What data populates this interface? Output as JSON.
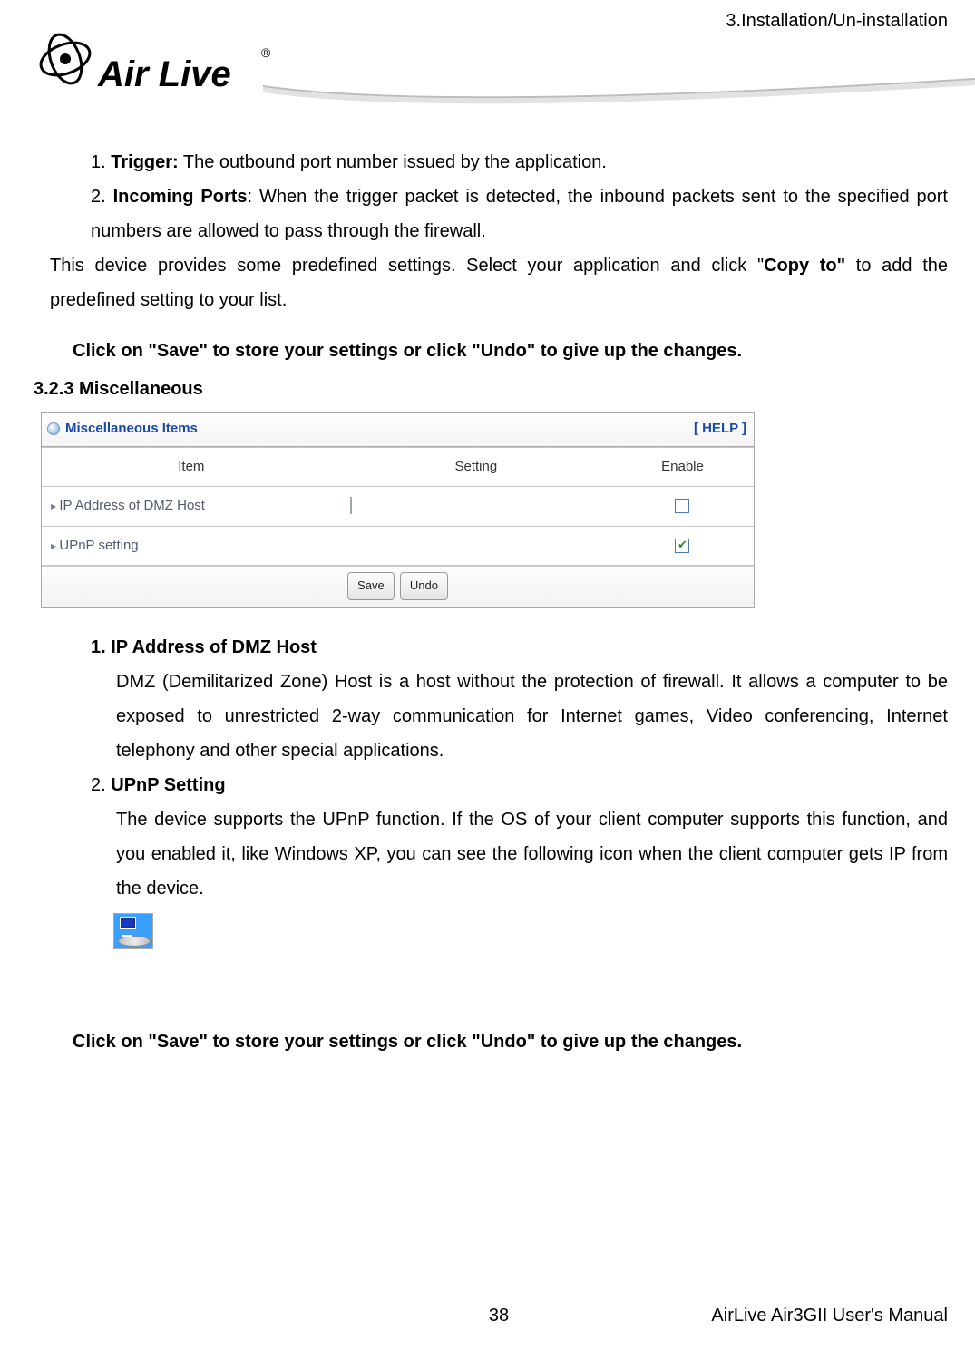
{
  "header": {
    "breadcrumb": "3.Installation/Un-installation",
    "brand_word1": "Air",
    "brand_word2": "Live",
    "brand_reg": "®"
  },
  "intro": {
    "item1_num": "1.",
    "item1_bold": "Trigger:",
    "item1_rest": " The outbound port number issued by the application.",
    "item2_num": "2.",
    "item2_bold": "Incoming Ports",
    "item2_rest": ": When the trigger packet is detected, the inbound packets sent to the specified port numbers are allowed to pass through the firewall.",
    "para_before_copy": "This device provides some predefined settings. Select your application and click \"",
    "copy_bold": "Copy to\"",
    "para_after_copy": " to add the predefined setting to your list.",
    "save_undo_line": "Click on \"Save\" to store your settings or click \"Undo\" to give up the changes."
  },
  "section": {
    "heading": "3.2.3 Miscellaneous"
  },
  "panel": {
    "title": "Miscellaneous Items",
    "help": "[ HELP ]",
    "headers": {
      "item": "Item",
      "setting": "Setting",
      "enable": "Enable"
    },
    "rows": {
      "r1_item": "IP Address of DMZ Host",
      "r2_item": "UPnP setting"
    },
    "buttons": {
      "save": "Save",
      "undo": "Undo"
    }
  },
  "misc_list": {
    "n1_num": "1.",
    "n1_bold": "IP Address of DMZ Host",
    "n1_text": "DMZ (Demilitarized Zone) Host is a host without the protection of firewall. It allows a computer to be exposed to unrestricted 2-way communication for Internet games, Video conferencing, Internet telephony and other special applications.",
    "n2_num": "2.",
    "n2_bold": "UPnP Setting",
    "n2_text": "The device supports the UPnP function. If the OS of your client computer supports this function, and you enabled it, like Windows XP, you can see the following icon when the client computer gets IP from the device."
  },
  "closing": {
    "save_undo_line": "Click on \"Save\" to store your settings or click \"Undo\" to give up the changes."
  },
  "footer": {
    "page": "38",
    "manual": "AirLive Air3GII User's Manual"
  }
}
